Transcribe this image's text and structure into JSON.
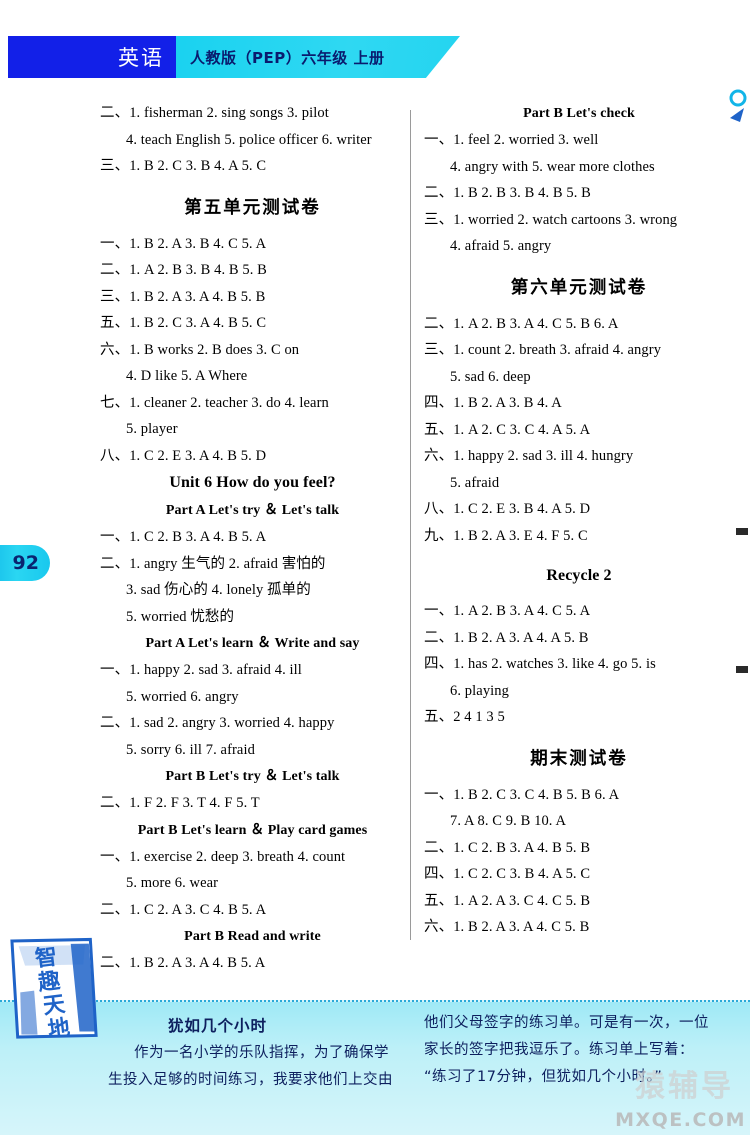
{
  "banner": {
    "subject": "英语",
    "edition": "人教版（PEP）六年级 上册"
  },
  "page_number": "92",
  "left_column": [
    {
      "type": "answer",
      "text": "二、1. fisherman   2. sing songs   3. pilot"
    },
    {
      "type": "answer-indent",
      "text": "4. teach English   5. police officer   6. writer"
    },
    {
      "type": "answer",
      "text": "三、1. B   2. C   3. B   4. A   5. C"
    },
    {
      "type": "gap-m"
    },
    {
      "type": "heading-cn",
      "text": "第五单元测试卷"
    },
    {
      "type": "gap-s"
    },
    {
      "type": "answer",
      "text": "一、1. B   2. A   3. B   4. C   5. A"
    },
    {
      "type": "answer",
      "text": "二、1. A   2. B   3. B   4. B   5. B"
    },
    {
      "type": "answer",
      "text": "三、1. B   2. A   3. A   4. B   5. B"
    },
    {
      "type": "answer",
      "text": "五、1. B   2. C   3. A   4. B   5. C"
    },
    {
      "type": "answer",
      "text": "六、1. B   works   2. B   does   3. C   on"
    },
    {
      "type": "answer-indent",
      "text": "4. D   like   5. A   Where"
    },
    {
      "type": "answer",
      "text": "七、1. cleaner   2. teacher   3. do   4. learn"
    },
    {
      "type": "answer-indent",
      "text": "5. player"
    },
    {
      "type": "answer",
      "text": "八、1. C   2. E   3. A   4. B   5. D"
    },
    {
      "type": "heading-en",
      "text": "Unit 6   How do you feel?"
    },
    {
      "type": "heading-part",
      "text": "Part A   Let's try ＆ Let's talk"
    },
    {
      "type": "answer",
      "text": "一、1. C   2. B   3. A   4. B   5. A"
    },
    {
      "type": "answer",
      "text": "二、1. angry 生气的   2. afraid 害怕的"
    },
    {
      "type": "answer-indent",
      "text": "3. sad 伤心的   4. lonely 孤单的"
    },
    {
      "type": "answer-indent",
      "text": "5. worried 忧愁的"
    },
    {
      "type": "heading-part",
      "text": "Part A   Let's learn ＆ Write and say"
    },
    {
      "type": "answer",
      "text": "一、1. happy   2. sad   3. afraid   4. ill"
    },
    {
      "type": "answer-indent",
      "text": "5. worried   6. angry"
    },
    {
      "type": "answer",
      "text": "二、1. sad   2. angry   3. worried   4. happy"
    },
    {
      "type": "answer-indent",
      "text": "5. sorry   6. ill   7. afraid"
    },
    {
      "type": "heading-part",
      "text": "Part B   Let's try ＆ Let's talk"
    },
    {
      "type": "answer",
      "text": "二、1. F   2. F   3. T   4. F   5. T"
    },
    {
      "type": "heading-part",
      "text": "Part B   Let's learn ＆ Play card games"
    },
    {
      "type": "answer",
      "text": "一、1. exercise   2. deep   3. breath   4. count"
    },
    {
      "type": "answer-indent",
      "text": "5. more   6. wear"
    },
    {
      "type": "answer",
      "text": "二、1. C   2. A   3. C   4. B   5. A"
    },
    {
      "type": "heading-part",
      "text": "Part B   Read and write"
    },
    {
      "type": "answer",
      "text": "二、1. B   2. A   3. A   4. B   5. A"
    }
  ],
  "right_column": [
    {
      "type": "heading-part",
      "text": "Part B   Let's check"
    },
    {
      "type": "answer",
      "text": "一、1. feel   2. worried   3. well"
    },
    {
      "type": "answer-indent",
      "text": "4. angry with   5. wear more clothes"
    },
    {
      "type": "answer",
      "text": "二、1. B   2. B   3. B   4. B   5. B"
    },
    {
      "type": "answer",
      "text": "三、1. worried   2. watch cartoons   3. wrong"
    },
    {
      "type": "answer-indent",
      "text": "4. afraid   5. angry"
    },
    {
      "type": "gap-m"
    },
    {
      "type": "heading-cn",
      "text": "第六单元测试卷"
    },
    {
      "type": "gap-s"
    },
    {
      "type": "answer",
      "text": "二、1. A   2. B   3. A   4. C   5. B   6. A"
    },
    {
      "type": "answer",
      "text": "三、1. count   2. breath   3. afraid   4. angry"
    },
    {
      "type": "answer-indent",
      "text": "5. sad   6. deep"
    },
    {
      "type": "answer",
      "text": "四、1. B   2. A   3. B   4. A"
    },
    {
      "type": "answer",
      "text": "五、1. A   2. C   3. C   4. A   5. A"
    },
    {
      "type": "answer",
      "text": "六、1. happy   2. sad   3. ill   4. hungry"
    },
    {
      "type": "answer-indent",
      "text": "5. afraid"
    },
    {
      "type": "answer",
      "text": "八、1. C   2. E   3. B   4. A   5. D"
    },
    {
      "type": "answer",
      "text": "九、1. B   2. A   3. E   4. F   5. C"
    },
    {
      "type": "gap-m"
    },
    {
      "type": "heading-en",
      "text": "Recycle 2"
    },
    {
      "type": "gap-s"
    },
    {
      "type": "answer",
      "text": "一、1. A   2. B   3. A   4. C   5. A"
    },
    {
      "type": "answer",
      "text": "二、1. B   2. A   3. A   4. A   5. B"
    },
    {
      "type": "answer",
      "text": "四、1. has   2. watches   3. like   4. go   5. is"
    },
    {
      "type": "answer-indent",
      "text": "6. playing"
    },
    {
      "type": "answer",
      "text": "五、2   4   1   3   5"
    },
    {
      "type": "gap-m"
    },
    {
      "type": "heading-cn",
      "text": "期末测试卷"
    },
    {
      "type": "gap-s"
    },
    {
      "type": "answer",
      "text": "一、1. B   2. C   3. C   4. B   5. B   6. A"
    },
    {
      "type": "answer-indent",
      "text": "7. A   8. C   9. B   10. A"
    },
    {
      "type": "answer",
      "text": "二、1. C   2. B   3. A   4. B   5. B"
    },
    {
      "type": "answer",
      "text": "四、1. C   2. C   3. B   4. A   5. C"
    },
    {
      "type": "answer",
      "text": "五、1. A   2. A   3. C   4. C   5. B"
    },
    {
      "type": "answer",
      "text": "六、1. B   2. A   3. A   4. C   5. B"
    }
  ],
  "ribbon": {
    "label": "智趣天地"
  },
  "footer": {
    "title": "犹如几个小时",
    "left_lines": [
      "作为一名小学的乐队指挥，为了确保学",
      "生投入足够的时间练习，我要求他们上交由"
    ],
    "right_lines": [
      "他们父母签字的练习单。可是有一次，一位",
      "家长的签字把我逗乐了。练习单上写着：",
      "“练习了17分钟，但犹如几个小时。”"
    ]
  },
  "watermark": {
    "cn": "猿辅导",
    "en": "MXQE.COM"
  },
  "colors": {
    "banner_blue": "#1220e8",
    "banner_cyan": "#25d5f1",
    "footer_cyan": "#9fe9f6",
    "text": "#000000",
    "footer_text": "#0d1f5e"
  }
}
